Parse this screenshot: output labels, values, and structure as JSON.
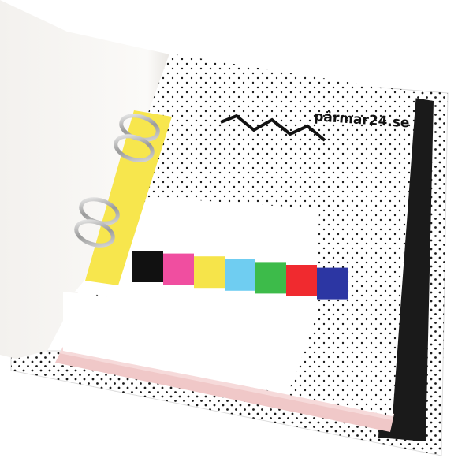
{
  "photo": {
    "subject": "ring-binder-product-photo",
    "background_color": "#ffffff"
  },
  "binder": {
    "cover_color": "#ffffff",
    "cover_pattern": "black-polka-dots",
    "spine_color": "#1a1a1a"
  },
  "divider": {
    "brand_text": "pärmar24.se",
    "zigzag_icon": "zigzag-line",
    "tab_color": "#f7e64d"
  },
  "color_bar": {
    "swatches": [
      {
        "name": "black",
        "color": "#111111"
      },
      {
        "name": "pink",
        "color": "#f04ea0"
      },
      {
        "name": "yellow",
        "color": "#f6e44a"
      },
      {
        "name": "cyan",
        "color": "#6fcdf1"
      },
      {
        "name": "green",
        "color": "#3dbb4a"
      },
      {
        "name": "red",
        "color": "#f02a2f"
      },
      {
        "name": "blue",
        "color": "#2c36a3"
      }
    ]
  }
}
